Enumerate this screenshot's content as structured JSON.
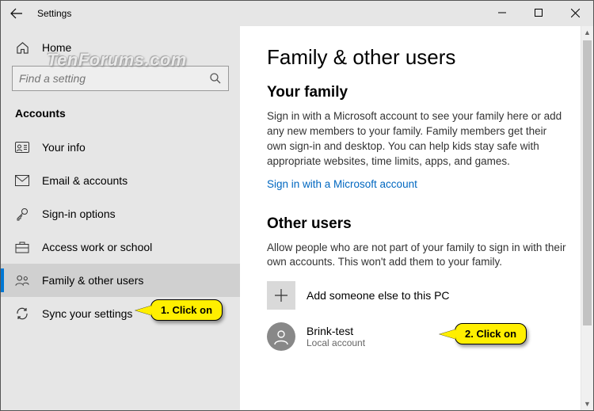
{
  "window": {
    "title": "Settings"
  },
  "sidebar": {
    "home": "Home",
    "search_placeholder": "Find a setting",
    "section": "Accounts",
    "items": [
      {
        "label": "Your info"
      },
      {
        "label": "Email & accounts"
      },
      {
        "label": "Sign-in options"
      },
      {
        "label": "Access work or school"
      },
      {
        "label": "Family & other users"
      },
      {
        "label": "Sync your settings"
      }
    ]
  },
  "main": {
    "title": "Family & other users",
    "family_heading": "Your family",
    "family_body": "Sign in with a Microsoft account to see your family here or add any new members to your family. Family members get their own sign-in and desktop. You can help kids stay safe with appropriate websites, time limits, apps, and games.",
    "signin_link": "Sign in with a Microsoft account",
    "other_heading": "Other users",
    "other_body": "Allow people who are not part of your family to sign in with their own accounts. This won't add them to your family.",
    "add_label": "Add someone else to this PC",
    "user": {
      "name": "Brink-test",
      "type": "Local account"
    }
  },
  "callouts": {
    "one": "1. Click on",
    "two": "2. Click on"
  },
  "watermark": "TenForums.com"
}
